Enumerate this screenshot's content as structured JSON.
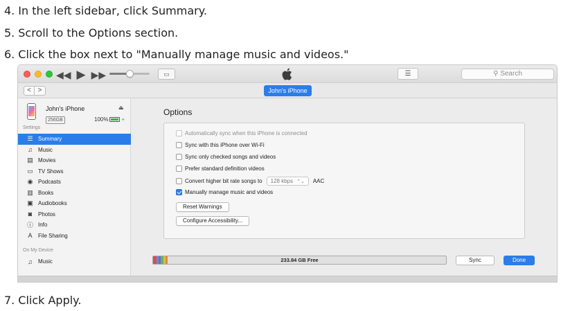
{
  "steps": {
    "s4": {
      "num": "4.",
      "text": "In the left sidebar, click Summary."
    },
    "s5": {
      "num": "5.",
      "text": "Scroll to the Options section."
    },
    "s6": {
      "num": "6.",
      "text": "Click the box next to \"Manually manage music and videos.\""
    },
    "s7": {
      "num": "7.",
      "text": "Click Apply."
    }
  },
  "titlebar": {
    "search_placeholder": "Search",
    "airplay_icon": "airplay-icon",
    "apple_logo": "apple-logo"
  },
  "navbar": {
    "back": "<",
    "forward": ">",
    "device_pill": "John's iPhone"
  },
  "device": {
    "name": "John's iPhone",
    "capacity": "256GB",
    "battery": "100%",
    "battery_color": "#3cb43c"
  },
  "sidebar": {
    "settings_label": "Settings",
    "items": [
      {
        "label": "Summary",
        "icon": "summary-icon",
        "glyph": "☰"
      },
      {
        "label": "Music",
        "icon": "music-note-icon",
        "glyph": "♫"
      },
      {
        "label": "Movies",
        "icon": "film-icon",
        "glyph": "▤"
      },
      {
        "label": "TV Shows",
        "icon": "tv-icon",
        "glyph": "▭"
      },
      {
        "label": "Podcasts",
        "icon": "podcast-icon",
        "glyph": "◉"
      },
      {
        "label": "Books",
        "icon": "book-icon",
        "glyph": "▥"
      },
      {
        "label": "Audiobooks",
        "icon": "audiobook-icon",
        "glyph": "▣"
      },
      {
        "label": "Photos",
        "icon": "camera-icon",
        "glyph": "◙"
      },
      {
        "label": "Info",
        "icon": "info-icon",
        "glyph": "ⓘ"
      },
      {
        "label": "File Sharing",
        "icon": "file-sharing-icon",
        "glyph": "A"
      }
    ],
    "on_device_label": "On My Device",
    "device_items": [
      {
        "label": "Music",
        "icon": "music-note-icon",
        "glyph": "♫"
      }
    ]
  },
  "options": {
    "title": "Options",
    "rows": [
      {
        "label": "Automatically sync when this iPhone is connected",
        "checked": false,
        "disabled": true
      },
      {
        "label": "Sync with this iPhone over Wi-Fi",
        "checked": false,
        "disabled": false
      },
      {
        "label": "Sync only checked songs and videos",
        "checked": false,
        "disabled": false
      },
      {
        "label": "Prefer standard definition videos",
        "checked": false,
        "disabled": false
      },
      {
        "label": "Convert higher bit rate songs to",
        "checked": false,
        "disabled": false
      },
      {
        "label": "Manually manage music and videos",
        "checked": true,
        "disabled": false
      }
    ],
    "bitrate_value": "128 kbps",
    "bitrate_suffix": "AAC",
    "reset_warnings": "Reset Warnings",
    "configure_accessibility": "Configure Accessibility..."
  },
  "footer": {
    "storage_free": "233.84 GB Free",
    "sync_label": "Sync",
    "done_label": "Done",
    "accent_color": "#2b7de9"
  }
}
